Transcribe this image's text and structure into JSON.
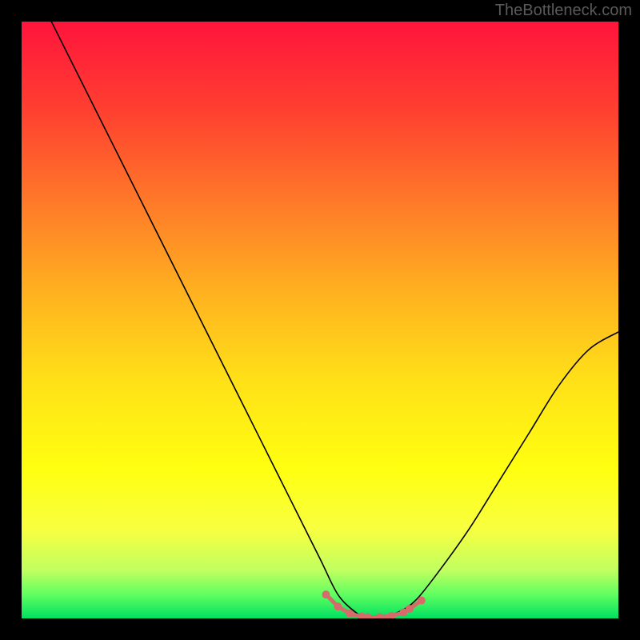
{
  "attribution": "TheBottleneck.com",
  "chart_data": {
    "type": "line",
    "title": "",
    "xlabel": "",
    "ylabel": "",
    "x_range": [
      0,
      100
    ],
    "y_range": [
      0,
      100
    ],
    "description": "Bottleneck curve. Color gradient background from red (high bottleneck) at the top to green (optimal) at the bottom. Black curve indicates bottleneck percentage versus relative performance. A cluster of pink/coral markers near the valley bottom indicates the target / recommended range.",
    "series": [
      {
        "name": "bottleneck-curve",
        "x": [
          5,
          10,
          15,
          20,
          25,
          30,
          35,
          40,
          45,
          50,
          53,
          56,
          58,
          60,
          63,
          66,
          70,
          75,
          80,
          85,
          90,
          95,
          100
        ],
        "y": [
          100,
          90,
          80,
          70,
          60,
          50,
          40,
          30,
          20,
          10,
          4,
          1,
          0,
          0,
          1,
          3,
          8,
          15,
          23,
          31,
          39,
          45,
          48
        ]
      }
    ],
    "markers": {
      "name": "optimal-range",
      "color": "#d76a6a",
      "x": [
        51,
        53,
        55,
        57,
        58,
        60,
        62,
        64,
        65,
        67
      ],
      "y": [
        4.0,
        2.0,
        0.8,
        0.3,
        0.2,
        0.2,
        0.4,
        1.0,
        1.6,
        3.0
      ]
    }
  }
}
